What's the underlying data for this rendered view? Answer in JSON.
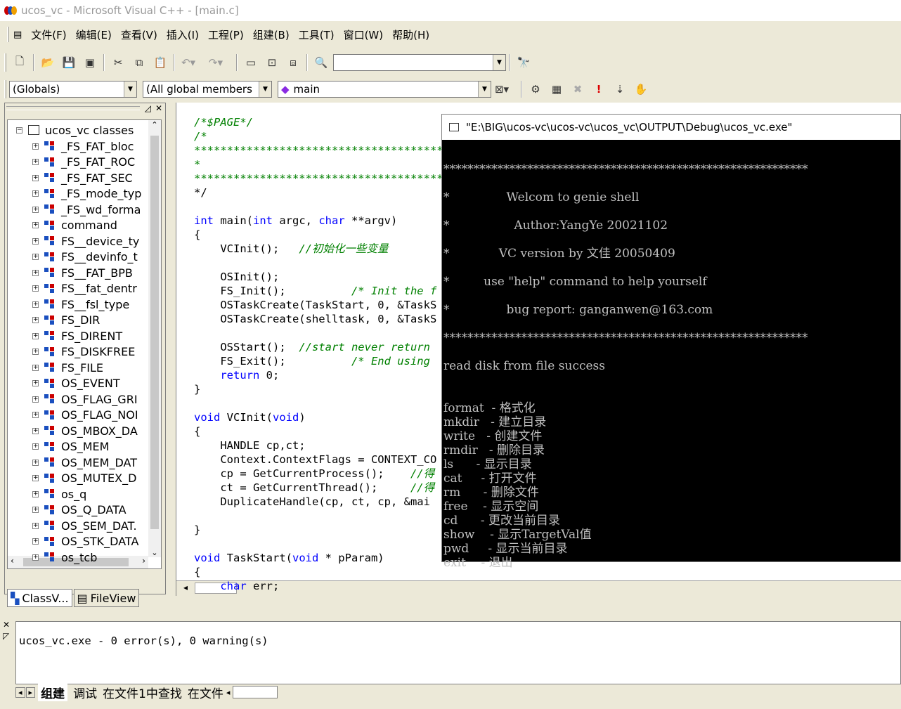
{
  "window_title": "ucos_vc - Microsoft Visual C++ - [main.c]",
  "menu": [
    "文件(F)",
    "编辑(E)",
    "查看(V)",
    "插入(I)",
    "工程(P)",
    "组建(B)",
    "工具(T)",
    "窗口(W)",
    "帮助(H)"
  ],
  "toolbar": {
    "search_combo": ""
  },
  "wizard": {
    "class_combo": "(Globals)",
    "members_combo": "(All global members",
    "func_combo": "main"
  },
  "workspace": {
    "root": "ucos_vc classes",
    "items": [
      "_FS_FAT_bloc",
      "_FS_FAT_ROC",
      "_FS_FAT_SEC",
      "_FS_mode_typ",
      "_FS_wd_forma",
      "command",
      "FS__device_ty",
      "FS__devinfo_t",
      "FS__FAT_BPB",
      "FS__fat_dentr",
      "FS__fsl_type",
      "FS_DIR",
      "FS_DIRENT",
      "FS_DISKFREE",
      "FS_FILE",
      "OS_EVENT",
      "OS_FLAG_GRI",
      "OS_FLAG_NOI",
      "OS_MBOX_DA",
      "OS_MEM",
      "OS_MEM_DAT",
      "OS_MUTEX_D",
      "os_q",
      "OS_Q_DATA",
      "OS_SEM_DAT.",
      "OS_STK_DATA",
      "os_tcb"
    ],
    "tabs": [
      "ClassV...",
      "FileView"
    ]
  },
  "code_lines": [
    "/*$PAGE*/",
    "/*",
    "*********************************************",
    "*",
    "*********************************************",
    "*/",
    "",
    "int main(int argc, char **argv)",
    "{",
    "    VCInit();   //初始化一些变量",
    "",
    "    OSInit();",
    "    FS_Init();          /* Init the f",
    "    OSTaskCreate(TaskStart, 0, &TaskS",
    "    OSTaskCreate(shelltask, 0, &TaskS",
    "",
    "    OSStart();  //start never return",
    "    FS_Exit();          /* End using",
    "    return 0;",
    "}",
    "",
    "void VCInit(void)",
    "{",
    "    HANDLE cp,ct;",
    "    Context.ContextFlags = CONTEXT_CO",
    "    cp = GetCurrentProcess();    //得",
    "    ct = GetCurrentThread();     //得",
    "    DuplicateHandle(cp, ct, cp, &mai",
    "",
    "}",
    "",
    "void TaskStart(void * pParam)",
    "{",
    "    char err;"
  ],
  "console": {
    "title": "\"E:\\BIG\\ucos-vc\\ucos-vc\\ucos_vc\\OUTPUT\\Debug\\ucos_vc.exe\"",
    "lines": [
      "",
      "*************************************************************",
      "",
      "*               Welcom to genie shell",
      "",
      "*                 Author:YangYe 20021102",
      "",
      "*             VC version by 文佳 20050409",
      "",
      "*         use \"help\" command to help yourself",
      "",
      "*               bug report: ganganwen@163.com",
      "",
      "*************************************************************",
      "",
      "read disk from file success",
      "",
      "",
      "format  - 格式化",
      "mkdir   - 建立目录",
      "write   - 创建文件",
      "rmdir   - 删除目录",
      "ls      - 显示目录",
      "cat     - 打开文件",
      "rm      - 删除文件",
      "free    - 显示空间",
      "cd      - 更改当前目录",
      "show    - 显示TargetVal值",
      "pwd     - 显示当前目录",
      "exit    - 退出"
    ]
  },
  "output": {
    "text": "ucos_vc.exe - 0 error(s), 0 warning(s)",
    "tabs": [
      "组建",
      "调试",
      "在文件1中查找",
      "在文件"
    ]
  }
}
